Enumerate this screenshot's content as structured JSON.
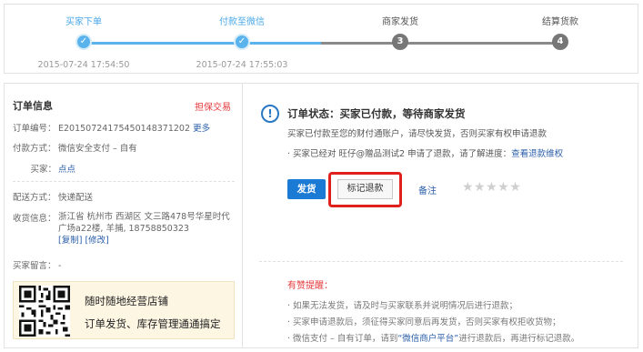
{
  "progress": {
    "steps": [
      {
        "label": "买家下单",
        "marker": "✓",
        "time": "2015-07-24 17:54:50"
      },
      {
        "label": "付款至微信",
        "marker": "✓",
        "time": "2015-07-24 17:55:03"
      },
      {
        "label": "商家发货",
        "marker": "3"
      },
      {
        "label": "结算货款",
        "marker": "4"
      }
    ],
    "colors": {
      "done": "#5ab3ec",
      "todo": "#777777"
    }
  },
  "order": {
    "title": "订单信息",
    "guarantee": "担保交易",
    "number_label": "订单编号：",
    "number": "E20150724175450148371202",
    "more_link": "更多",
    "payment_label": "付款方式：",
    "payment": "微信安全支付 – 自有",
    "buyer_label": "买家：",
    "buyer": "点点",
    "delivery_label": "配送方式：",
    "delivery": "快递配送",
    "recipient_label": "收货信息：",
    "recipient": "浙江省 杭州市 西湖区 文三路478号华星时代广场a22楼, 羊捕, 18758850323",
    "copy_link": "[复制]",
    "edit_link": "[修改]",
    "message_label": "买家留言：",
    "message": "-"
  },
  "promo": {
    "line1": "随时随地经营店铺",
    "line2": "订单发货、库存管理通通搞定"
  },
  "status": {
    "icon": "info-icon",
    "title": "订单状态：买家已付款，等待商家发货",
    "desc": "买家已付款至您的财付通账户，请尽快发货，否则买家有权申请退款",
    "note_prefix": "· 买家已经对 旺仔@赠品测试2 申请了退款，请了解进度：",
    "note_link": "查看退款维权",
    "ship_button": "发货",
    "refund_button": "标记退款",
    "remark_link": "备注",
    "stars": "★★★★★",
    "accent": "#1a7ad4",
    "highlight": "#e0201c"
  },
  "tips": {
    "title": "有赞提醒：",
    "items": [
      "· 如果无法发货，请及时与买家联系并说明情况后进行退款；",
      "· 买家申请退款后，须征得买家同意后再发货，否则买家有权拒收货物；"
    ],
    "last_prefix": "· 微信支付 – 自有订单，请到",
    "last_link": "“微信商户平台”",
    "last_suffix": "进行退款后，再进行标记退款。"
  }
}
